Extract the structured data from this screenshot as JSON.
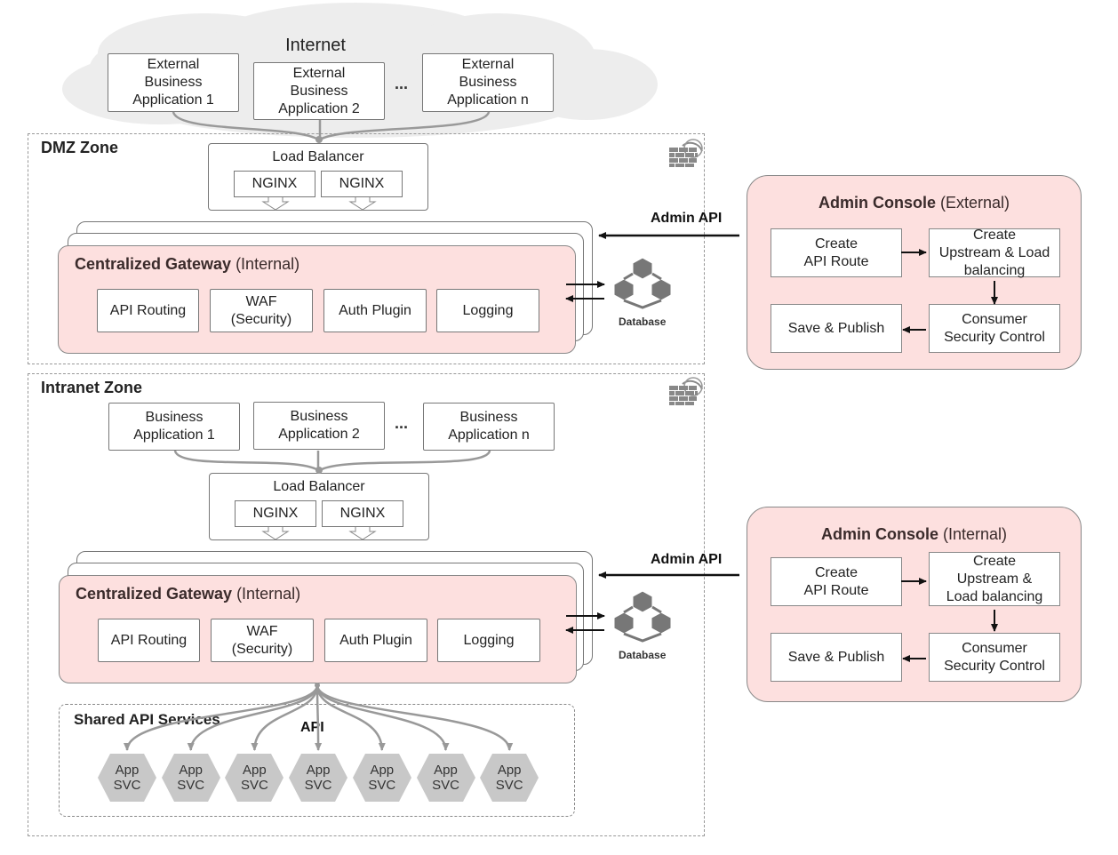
{
  "internet": {
    "title": "Internet",
    "apps": [
      "External\nBusiness\nApplication 1",
      "External\nBusiness\nApplication 2",
      "External\nBusiness\nApplication n"
    ],
    "ellipsis": "..."
  },
  "dmz": {
    "title": "DMZ Zone",
    "load_balancer": {
      "title": "Load Balancer",
      "nodes": [
        "NGINX",
        "NGINX"
      ]
    },
    "gateway": {
      "title_bold": "Centralized Gateway",
      "title_rest": " (Internal)",
      "modules": [
        "API Routing",
        "WAF\n(Security)",
        "Auth Plugin",
        "Logging"
      ]
    },
    "database_label": "Database",
    "admin_api_label": "Admin API"
  },
  "intranet": {
    "title": "Intranet Zone",
    "apps": [
      "Business\nApplication 1",
      "Business\nApplication 2",
      "Business\nApplication n"
    ],
    "ellipsis": "...",
    "load_balancer": {
      "title": "Load Balancer",
      "nodes": [
        "NGINX",
        "NGINX"
      ]
    },
    "gateway": {
      "title_bold": "Centralized Gateway",
      "title_rest": " (Internal)",
      "modules": [
        "API Routing",
        "WAF\n(Security)",
        "Auth Plugin",
        "Logging"
      ]
    },
    "database_label": "Database",
    "admin_api_label": "Admin API",
    "shared_services": {
      "title": "Shared API Services",
      "api_label": "API",
      "services": [
        "App\nSVC",
        "App\nSVC",
        "App\nSVC",
        "App\nSVC",
        "App\nSVC",
        "App\nSVC",
        "App\nSVC"
      ]
    }
  },
  "admin_console_external": {
    "title_bold": "Admin Console",
    "title_rest": " (External)",
    "steps": [
      "Create\nAPI Route",
      "Create\nUpstream & Load\nbalancing",
      "Consumer\nSecurity Control",
      "Save & Publish"
    ]
  },
  "admin_console_internal": {
    "title_bold": "Admin Console",
    "title_rest": " (Internal)",
    "steps": [
      "Create\nAPI Route",
      "Create\nUpstream &\nLoad balancing",
      "Consumer\nSecurity Control",
      "Save & Publish"
    ]
  },
  "colors": {
    "gateway_fill": "#fde0df",
    "cloud_fill": "#eeeeee",
    "connector_gray": "#999999",
    "icon_gray": "#777777",
    "hex_fill": "#c8c8c8"
  }
}
